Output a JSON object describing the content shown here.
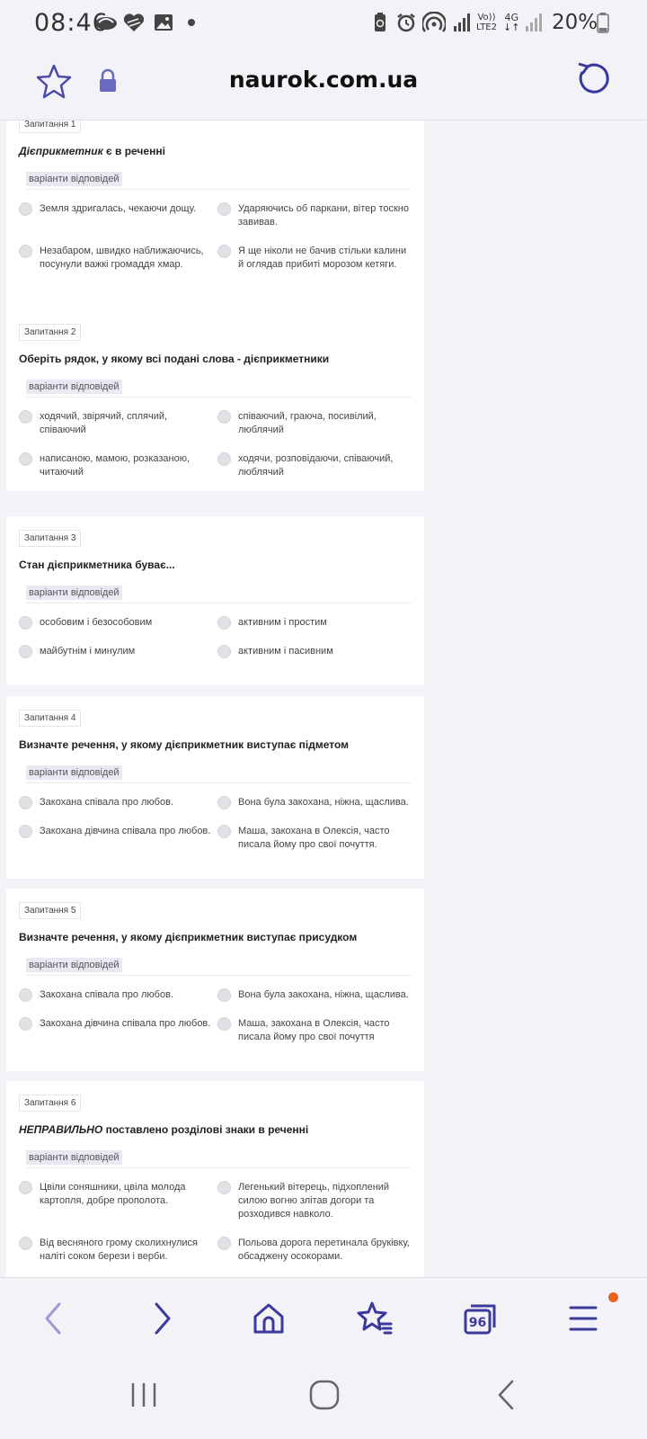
{
  "status_bar": {
    "time": "08:46",
    "battery": "20%",
    "volte_label_1": "Vo))",
    "volte_label_2": "LTE2",
    "network_type": "4G",
    "icons": [
      "cloud-icon",
      "heart-icon",
      "gallery-icon",
      "dot-icon",
      "battery-saver-icon",
      "alarm-icon",
      "hotspot-icon",
      "signal-icon",
      "signal-icon-2",
      "battery-icon"
    ]
  },
  "browser": {
    "url": "naurok.com.ua",
    "icons": [
      "star-icon",
      "lock-icon",
      "reload-icon"
    ]
  },
  "answers_label": "варіанти відповідей",
  "questions": [
    {
      "badge": "Запитання 1",
      "title_em": "Дієприкметник",
      "title_rest": " є в реченні",
      "options": [
        "Земля здригалась, чекаючи дощу.",
        "Ударяючись об паркани, вітер тоскно завивав.",
        "Незабаром, швидко наближаючись, посунули важкі громаддя хмар.",
        "Я ще ніколи не бачив стільки калини й оглядав прибиті морозом кетяги."
      ]
    },
    {
      "badge": "Запитання 2",
      "title_em": "",
      "title_rest": "Оберіть рядок, у якому всі подані слова - дієприкметники",
      "options": [
        "ходячий, звірячий, сплячий, співаючий",
        "співаючий, граюча, посивілий, люблячий",
        "написаною, мамою, розказаною, читаючий",
        "ходячи, розповідаючи, співаючий, люблячий"
      ]
    },
    {
      "badge": "Запитання 3",
      "title_em": "",
      "title_rest": "Стан дієприкметника буває...",
      "options": [
        "особовим і безособовим",
        "активним і простим",
        "майбутнім і минулим",
        "активним і пасивним"
      ]
    },
    {
      "badge": "Запитання 4",
      "title_em": "",
      "title_rest": "Визначте речення, у якому дієприкметник виступає підметом",
      "options": [
        "Закохана співала про любов.",
        "Вона була закохана, ніжна, щаслива.",
        "Закохана дівчина співала про любов.",
        "Маша, закохана в Олексія, часто писала йому про свої почуття."
      ]
    },
    {
      "badge": "Запитання 5",
      "title_em": "",
      "title_rest": "Визначте речення, у якому дієприкметник виступає присудком",
      "options": [
        "Закохана співала про любов.",
        "Вона була закохана, ніжна, щаслива.",
        "Закохана дівчина співала про любов.",
        "Маша, закохана в Олексія, часто писала йому про свої почуття"
      ]
    },
    {
      "badge": "Запитання 6",
      "title_em": "НЕПРАВИЛЬНО",
      "title_rest": " поставлено розділові знаки в реченні",
      "options": [
        "Цвіли соняшники, цвіла молода картопля, добре прополота.",
        "Легенький вітерець, підхоплений силою вогню злітав догори та розходився навколо.",
        "Від весняного грому сколихнулися наліті соком берези і верби.",
        "Польова дорога перетинала бруківку, обсаджену осокорами."
      ]
    }
  ],
  "bottom_nav": {
    "icons": [
      "back-arrow-icon",
      "forward-arrow-icon",
      "home-icon",
      "bookmarks-icon",
      "tabs-icon",
      "menu-icon"
    ],
    "tabs_count": "96"
  },
  "colors": {
    "accent": "#3a3a9e",
    "notification": "#e8621e",
    "background": "#f3f2f7"
  }
}
